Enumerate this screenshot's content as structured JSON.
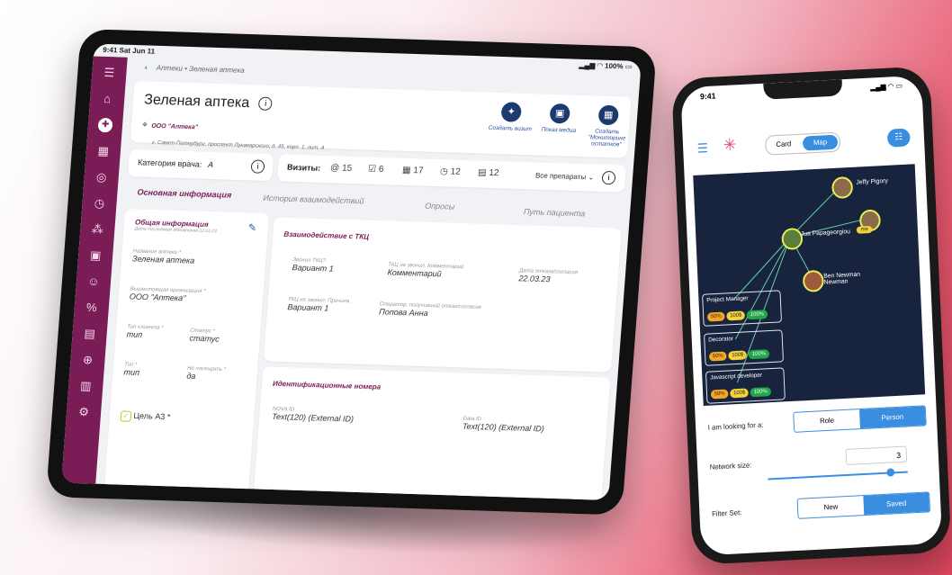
{
  "tablet": {
    "status": {
      "time": "9:41  Sat Jun 11",
      "battery": "100%"
    },
    "breadcrumb": {
      "parent": "Аптеки",
      "sep": "•",
      "current": "Зеленая аптека"
    },
    "header": {
      "title": "Зеленая аптека",
      "org": "ООО \"Аптека\"",
      "address": "г. Санкт-Петербург, проспект Луначарского, д. 45, корп. 1, лит. А",
      "actions": [
        {
          "label": "Создать визит",
          "icon": "handshake-icon"
        },
        {
          "label": "Показ медиа",
          "icon": "media-icon"
        },
        {
          "label": "Создать \"Мониторинг остатков\"",
          "icon": "calendar-icon"
        }
      ]
    },
    "category": {
      "label": "Категория врача:",
      "value": "А"
    },
    "visits": {
      "label": "Визиты:",
      "counts": [
        {
          "icon": "at-icon",
          "value": "15"
        },
        {
          "icon": "check-icon",
          "value": "6"
        },
        {
          "icon": "calendar-icon",
          "value": "17"
        },
        {
          "icon": "clock-icon",
          "value": "12"
        },
        {
          "icon": "document-icon",
          "value": "12"
        }
      ],
      "filter": "Все препараты"
    },
    "tabs": [
      "Основная информация",
      "История взаимодействий",
      "Опросы",
      "Путь пациента"
    ],
    "general": {
      "title": "Общая информация",
      "subtitle": "Дата последнего обновления 22.03.23",
      "fields": [
        {
          "label": "Название аптеки *",
          "value": "Зеленая аптека"
        },
        {
          "label": "Вышестоящая организация *",
          "value": "ООО \"Аптека\""
        },
        {
          "label": "Тип клиента *",
          "value": "тип"
        },
        {
          "label": "Статус *",
          "value": "статус"
        },
        {
          "label": "Тип *",
          "value": "тип"
        },
        {
          "label": "Не посещать *",
          "value": "да"
        }
      ],
      "goal": "Цель А3 *"
    },
    "interaction": {
      "title": "Взаимодействие с ТКЦ",
      "fields": [
        {
          "label": "Звонил ТКЦ?",
          "value": "Вариант 1"
        },
        {
          "label": "ТКЦ не звонил. Комментарий",
          "value": "Комментарий"
        },
        {
          "label": "Дата отказа/согласия",
          "value": "22.03.23"
        },
        {
          "label": "ТКЦ не звонил. Причина",
          "value": "Вариант 1"
        },
        {
          "label": "Оператор, получивший отказ/согласие",
          "value": "Попова Анна"
        }
      ]
    },
    "ids": {
      "title": "Идентификационные номера",
      "fields": [
        {
          "label": "NOVA ID",
          "value": "Text(120) (External ID)"
        },
        {
          "label": "Data ID",
          "value": "Text(120) (External ID)"
        }
      ]
    }
  },
  "phone": {
    "status": {
      "time": "9:41"
    },
    "toggle": [
      "Card",
      "Map"
    ],
    "nodes": [
      {
        "name": "Jeffy Pigory"
      },
      {
        "name": "Jua Papageorgiou"
      },
      {
        "name": "me"
      },
      {
        "name": "Ben Newman Newman"
      }
    ],
    "roles": [
      {
        "name": "Project Manager",
        "pills": [
          "50%",
          "100$",
          "100%"
        ]
      },
      {
        "name": "Decorator",
        "pills": [
          "50%",
          "100$",
          "100%"
        ]
      },
      {
        "name": "Javascript developer",
        "pills": [
          "50%",
          "100$",
          "100%"
        ]
      }
    ],
    "looking": {
      "label": "I am looking for a:",
      "options": [
        "Role",
        "Person"
      ]
    },
    "network": {
      "label": "Network size:",
      "value": "3",
      "slider_fraction": 0.85
    },
    "filter": {
      "label": "Filter Set:",
      "options": [
        "New",
        "Saved"
      ]
    }
  }
}
